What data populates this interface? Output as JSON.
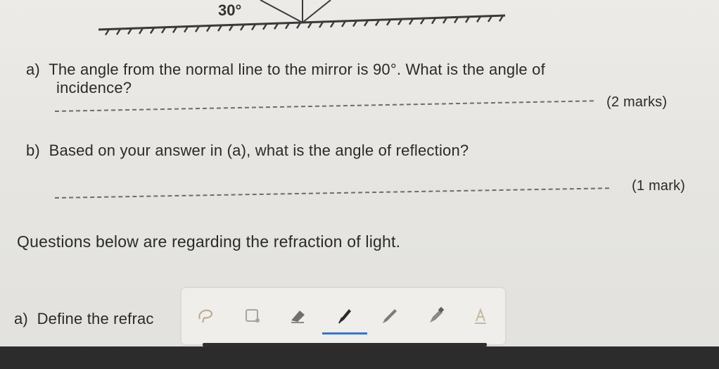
{
  "diagram": {
    "angle_label": "30°"
  },
  "question_a": {
    "line1": "a)  The angle from the normal line to the mirror is 90°. What is the angle of",
    "line2": "incidence?",
    "marks": "(2 marks)"
  },
  "question_b": {
    "text": "b)  Based on your answer in (a), what is the angle of reflection?",
    "marks": "(1 mark)"
  },
  "section": {
    "heading": "Questions below are regarding the refraction of light."
  },
  "question_c": {
    "text": "a)  Define the refrac"
  },
  "toolbar": {
    "tools": [
      "lasso-icon",
      "shapes-icon",
      "eraser-icon",
      "pen-icon",
      "pencil-icon",
      "marker-icon",
      "text-icon"
    ],
    "active_color": "#2f78d8"
  }
}
